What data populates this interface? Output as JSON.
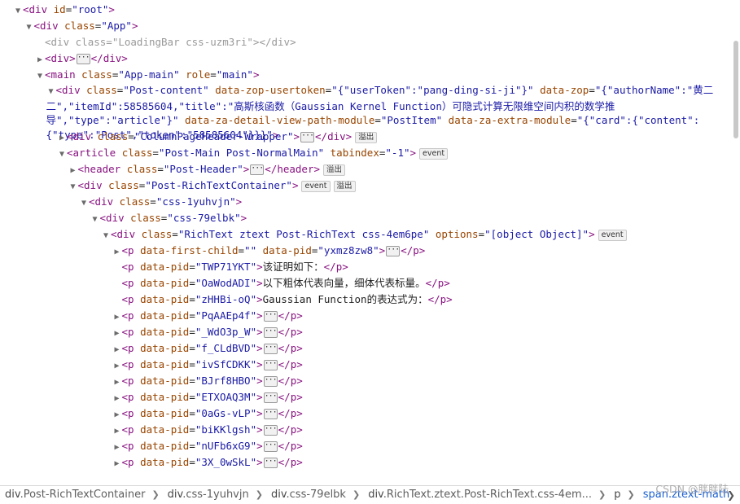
{
  "nodes": [
    {
      "indent": 0,
      "twisty": "▼",
      "open": "<div id=\"root\">"
    },
    {
      "indent": 1,
      "twisty": "▼",
      "open": "<div class=\"App\">"
    },
    {
      "indent": 2,
      "twisty": "",
      "open": "<div class=\"LoadingBar css-uzm3ri\"></div>"
    },
    {
      "indent": 2,
      "twisty": "▶",
      "open": "<div>",
      "ell": true,
      "close": "</div>"
    },
    {
      "indent": 2,
      "twisty": "▼",
      "open": "<main class=\"App-main\" role=\"main\">"
    },
    {
      "indent": 3,
      "twisty": "▼",
      "open": "<div class=\"Post-content\" data-zop-usertoken=\"{\"userToken\":\"pang-ding-si-ji\"}\" data-zop=\"{\"authorName\":\"黄二二\",\"itemId\":58585604,\"title\":\"高斯核函数（Gaussian Kernel Function）可隐式计算无限维空间内积的数学推导\",\"type\":\"article\"}\" data-za-detail-view-path-module=\"PostItem\" data-za-extra-module=\"{\"card\":{\"content\":{\"type\":\"Post\",\"token\":\"58585604\"}}}\">"
    },
    {
      "indent": 4,
      "twisty": "▶",
      "open": "<div class=\"ColumnPageHeader-Wrapper\">",
      "ell": true,
      "close": "</div>",
      "badge": "溢出"
    },
    {
      "indent": 4,
      "twisty": "▼",
      "open": "<article class=\"Post-Main Post-NormalMain\" tabindex=\"-1\">",
      "badge": "event"
    },
    {
      "indent": 5,
      "twisty": "▶",
      "open": "<header class=\"Post-Header\">",
      "ell": true,
      "close": "</header>",
      "badge": "溢出"
    },
    {
      "indent": 5,
      "twisty": "▼",
      "open": "<div class=\"Post-RichTextContainer\">",
      "badge": "event",
      "badge2": "溢出"
    },
    {
      "indent": 6,
      "twisty": "▼",
      "open": "<div class=\"css-1yuhvjn\">"
    },
    {
      "indent": 7,
      "twisty": "▼",
      "open": "<div class=\"css-79elbk\">"
    },
    {
      "indent": 8,
      "twisty": "▼",
      "open": "<div class=\"RichText ztext Post-RichText css-4em6pe\" options=\"[object Object]\">",
      "badge": "event"
    },
    {
      "indent": 9,
      "twisty": "▶",
      "open": "<p data-first-child=\"\" data-pid=\"yxmz8zw8\">",
      "ell": true,
      "close": "</p>"
    },
    {
      "indent": 9,
      "twisty": "",
      "open": "<p data-pid=\"TWP71YKT\">",
      "text": "该证明如下：",
      "close": "</p>"
    },
    {
      "indent": 9,
      "twisty": "",
      "open": "<p data-pid=\"OaWodADI\">",
      "text": "以下粗体代表向量，细体代表标量。",
      "close": "</p>"
    },
    {
      "indent": 9,
      "twisty": "",
      "open": "<p data-pid=\"zHHBi-oQ\">",
      "text": "Gaussian Function的表达式为：",
      "close": "</p>"
    },
    {
      "indent": 9,
      "twisty": "▶",
      "open": "<p data-pid=\"PqAAEp4f\">",
      "ell": true,
      "close": "</p>"
    },
    {
      "indent": 9,
      "twisty": "▶",
      "open": "<p data-pid=\"_WdO3p_W\">",
      "ell": true,
      "close": "</p>"
    },
    {
      "indent": 9,
      "twisty": "▶",
      "open": "<p data-pid=\"f_CLdBVD\">",
      "ell": true,
      "close": "</p>"
    },
    {
      "indent": 9,
      "twisty": "▶",
      "open": "<p data-pid=\"ivSfCDKK\">",
      "ell": true,
      "close": "</p>"
    },
    {
      "indent": 9,
      "twisty": "▶",
      "open": "<p data-pid=\"BJrf8HBO\">",
      "ell": true,
      "close": "</p>"
    },
    {
      "indent": 9,
      "twisty": "▶",
      "open": "<p data-pid=\"ETXOAQ3M\">",
      "ell": true,
      "close": "</p>"
    },
    {
      "indent": 9,
      "twisty": "▶",
      "open": "<p data-pid=\"0aGs-vLP\">",
      "ell": true,
      "close": "</p>"
    },
    {
      "indent": 9,
      "twisty": "▶",
      "open": "<p data-pid=\"biKKlgsh\">",
      "ell": true,
      "close": "</p>"
    },
    {
      "indent": 9,
      "twisty": "▶",
      "open": "<p data-pid=\"nUFb6xG9\">",
      "ell": true,
      "close": "</p>"
    },
    {
      "indent": 9,
      "twisty": "▶",
      "open": "<p data-pid=\"3X_0wSkL\">",
      "ell": true,
      "close": "</p>"
    }
  ],
  "ellipsis": "···",
  "breadcrumbs": [
    {
      "tag": "div",
      "cls": ".Post-RichTextContainer"
    },
    {
      "tag": "div",
      "cls": ".css-1yuhvjn"
    },
    {
      "tag": "div",
      "cls": ".css-79elbk"
    },
    {
      "tag": "div",
      "cls": ".RichText.ztext.Post-RichText.css-4em..."
    },
    {
      "tag": "p",
      "cls": ""
    },
    {
      "tag": "span",
      "cls": ".ztext-math",
      "active": true
    }
  ],
  "watermark": "CSDN @胖胖陆"
}
